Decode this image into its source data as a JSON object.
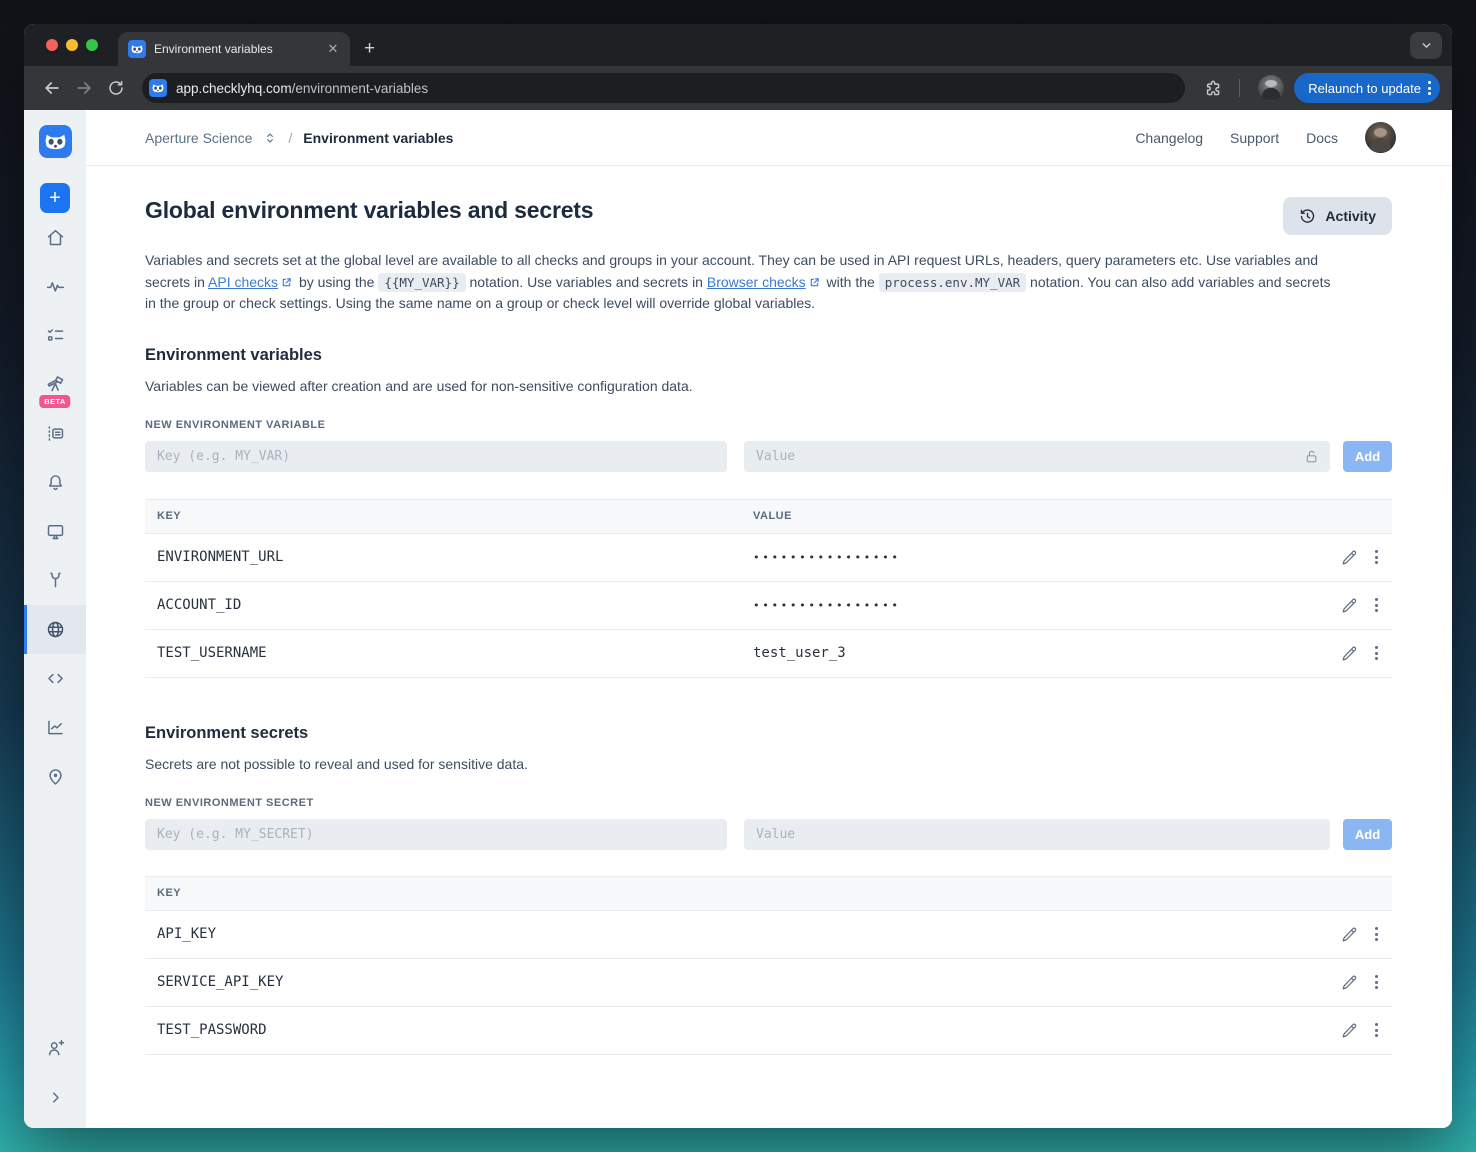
{
  "browser": {
    "tab_title": "Environment variables",
    "url_domain": "app.checklyhq.com",
    "url_path": "/environment-variables",
    "relaunch_label": "Relaunch to update"
  },
  "header": {
    "account_name": "Aperture Science",
    "separator": "/",
    "page_title": "Environment variables",
    "links": [
      "Changelog",
      "Support",
      "Docs"
    ]
  },
  "sidebar": {
    "beta_badge": "BETA",
    "items": [
      {
        "icon": "checkly-logo"
      },
      {
        "icon": "new-check-plus"
      },
      {
        "icon": "home"
      },
      {
        "icon": "monitoring-pulse"
      },
      {
        "icon": "checks-list"
      },
      {
        "icon": "detect-telescope",
        "badge": "BETA"
      },
      {
        "icon": "test-sessions"
      },
      {
        "icon": "alerts-bell"
      },
      {
        "icon": "dashboards-monitor"
      },
      {
        "icon": "maintenance-wrench"
      },
      {
        "icon": "environment-variables-globe",
        "active": true
      },
      {
        "icon": "snippets-code"
      },
      {
        "icon": "analytics-chart"
      },
      {
        "icon": "private-locations-pin"
      },
      {
        "icon": "invite-user"
      },
      {
        "icon": "collapse-chevron"
      }
    ]
  },
  "colors": {
    "checkly_blue": "#1d74f0",
    "add_button_blue": "#8ab7f4",
    "beta_pink": "#f0568f",
    "relaunch_blue": "#1868c9",
    "active_border_blue": "#2f7cf6"
  },
  "main": {
    "title": "Global environment variables and secrets",
    "activity_label": "Activity",
    "intro_parts": [
      {
        "t": "text",
        "v": "Variables and secrets set at the global level are available to all checks and groups in your account. They can be used in API request URLs, headers, query parameters etc. Use variables and secrets in "
      },
      {
        "t": "link",
        "v": "API checks"
      },
      {
        "t": "text",
        "v": " by using the "
      },
      {
        "t": "code",
        "v": "{{MY_VAR}}"
      },
      {
        "t": "text",
        "v": " notation. Use variables and secrets in "
      },
      {
        "t": "link",
        "v": "Browser checks"
      },
      {
        "t": "text",
        "v": " with the "
      },
      {
        "t": "code",
        "v": "process.env.MY_VAR"
      },
      {
        "t": "text",
        "v": " notation. You can also add variables and secrets in the group or check settings. Using the same name on a group or check level will override global variables."
      }
    ],
    "variables": {
      "heading": "Environment variables",
      "description": "Variables can be viewed after creation and are used for non-sensitive configuration data.",
      "form_label": "NEW ENVIRONMENT VARIABLE",
      "key_placeholder": "Key (e.g. MY_VAR)",
      "value_placeholder": "Value",
      "add_label": "Add",
      "columns": {
        "key": "KEY",
        "value": "VALUE"
      },
      "rows": [
        {
          "key": "ENVIRONMENT_URL",
          "value": "••••••••••••••••",
          "masked": true
        },
        {
          "key": "ACCOUNT_ID",
          "value": "••••••••••••••••",
          "masked": true
        },
        {
          "key": "TEST_USERNAME",
          "value": "test_user_3",
          "masked": false
        }
      ]
    },
    "secrets": {
      "heading": "Environment secrets",
      "description": "Secrets are not possible to reveal and used for sensitive data.",
      "form_label": "NEW ENVIRONMENT SECRET",
      "key_placeholder": "Key (e.g. MY_SECRET)",
      "value_placeholder": "Value",
      "add_label": "Add",
      "columns": {
        "key": "KEY"
      },
      "rows": [
        {
          "key": "API_KEY"
        },
        {
          "key": "SERVICE_API_KEY"
        },
        {
          "key": "TEST_PASSWORD"
        }
      ]
    }
  }
}
